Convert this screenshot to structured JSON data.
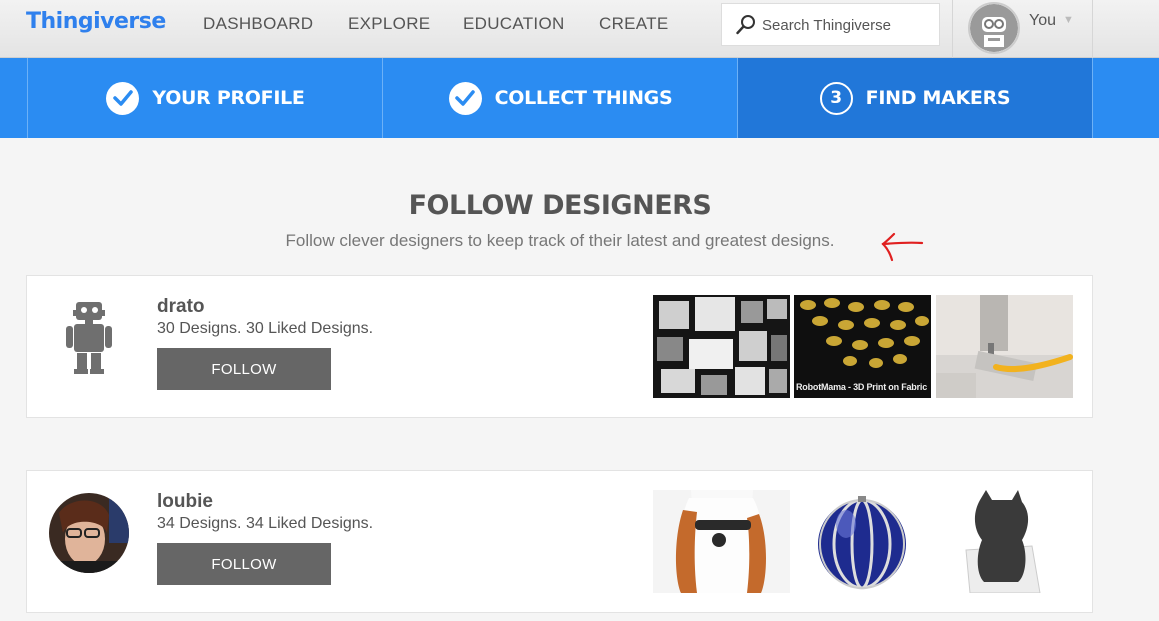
{
  "header": {
    "logo": "Thingiverse",
    "nav": [
      "DASHBOARD",
      "EXPLORE",
      "EDUCATION",
      "CREATE"
    ],
    "search_placeholder": "Search Thingiverse",
    "user_label": "You"
  },
  "steps": [
    {
      "label": "YOUR PROFILE",
      "state": "done"
    },
    {
      "label": "COLLECT THINGS",
      "state": "done"
    },
    {
      "label": "FIND MAKERS",
      "number": "3",
      "state": "active"
    }
  ],
  "section": {
    "title": "FOLLOW DESIGNERS",
    "subtitle": "Follow clever designers to keep track of their latest and greatest designs."
  },
  "designers": [
    {
      "name": "drato",
      "stats": "30 Designs. 30 Liked Designs.",
      "follow_label": "FOLLOW",
      "thumb_caption": "RobotMama - 3D Print on Fabric"
    },
    {
      "name": "loubie",
      "stats": "34 Designs. 34 Liked Designs.",
      "follow_label": "FOLLOW"
    }
  ],
  "colors": {
    "brand": "#2f80ed",
    "steps_bar": "#2b8cf2",
    "steps_active": "#2177d9",
    "button": "#666666",
    "annotation": "#e02020"
  }
}
